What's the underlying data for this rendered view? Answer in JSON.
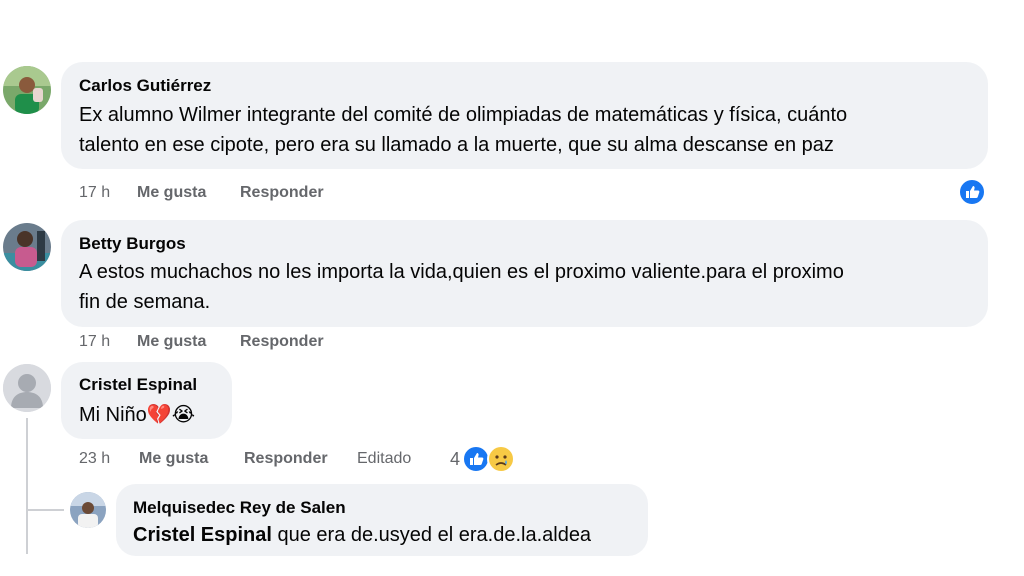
{
  "comments": [
    {
      "author": "Carlos Gutiérrez",
      "lines": [
        "Ex alumno Wilmer integrante del comité de olimpiadas de matemáticas y física, cuánto",
        "talento en ese cipote, pero era su llamado a la muerte, que su alma descanse en paz"
      ],
      "time": "17 h",
      "like_label": "Me gusta",
      "reply_label": "Responder",
      "reaction_icon": "like-icon"
    },
    {
      "author": "Betty Burgos",
      "lines": [
        "A estos muchachos no les importa la vida,quien es el proximo valiente.para el proximo",
        "fin de semana."
      ],
      "time": "17 h",
      "like_label": "Me gusta",
      "reply_label": "Responder"
    },
    {
      "author": "Cristel Espinal",
      "text": "Mi Niño",
      "emojis": [
        "💔",
        "😭"
      ],
      "time": "23 h",
      "like_label": "Me gusta",
      "reply_label": "Responder",
      "edited_label": "Editado",
      "reaction_count": "4",
      "reaction_icons": [
        "like-icon",
        "sad-icon"
      ]
    }
  ],
  "reply": {
    "author": "Melquisedec Rey de Salen",
    "mention": "Cristel Espinal",
    "text": " que era de.usyed el era.de.la.aldea"
  },
  "colors": {
    "bubble": "#f0f2f5",
    "meta_text": "#65676b",
    "like_blue": "#1877f2",
    "thread_line": "#ced0d4"
  }
}
